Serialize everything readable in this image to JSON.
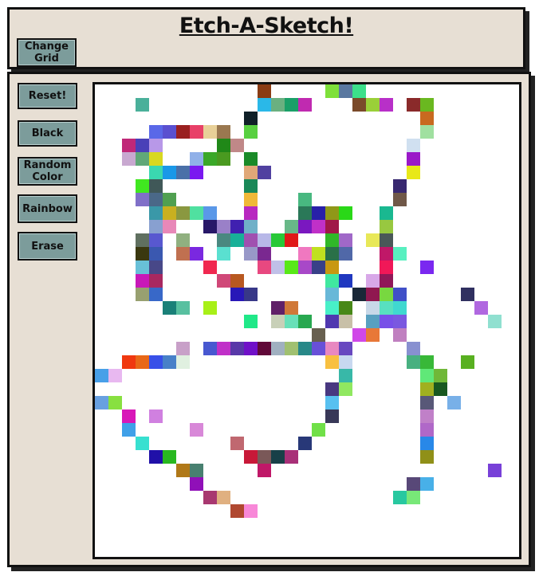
{
  "header": {
    "title": "Etch-A-Sketch!",
    "change_grid_label": "Change\nGrid"
  },
  "toolbar": {
    "reset_label": "Reset!",
    "black_label": "Black",
    "random_color_label": "Random\nColor",
    "rainbow_label": "Rainbow",
    "erase_label": "Erase"
  },
  "grid": {
    "columns": 30,
    "rows": 33,
    "background": "#ffffff",
    "cells": [
      [
        12,
        0,
        "#8a3c14"
      ],
      [
        17,
        0,
        "#7ee03a"
      ],
      [
        18,
        0,
        "#5a78a0"
      ],
      [
        19,
        0,
        "#3ce08a"
      ],
      [
        3,
        1,
        "#4ab09a"
      ],
      [
        12,
        1,
        "#2ab8e8"
      ],
      [
        13,
        1,
        "#6ab080"
      ],
      [
        14,
        1,
        "#1aa068"
      ],
      [
        15,
        1,
        "#c02ab0"
      ],
      [
        19,
        1,
        "#7a4a2a"
      ],
      [
        20,
        1,
        "#9ad038"
      ],
      [
        21,
        1,
        "#b830c8"
      ],
      [
        23,
        1,
        "#8a2a2a"
      ],
      [
        24,
        1,
        "#6ab820"
      ],
      [
        11,
        2,
        "#102028"
      ],
      [
        24,
        2,
        "#c86a20"
      ],
      [
        4,
        3,
        "#5a68e8"
      ],
      [
        5,
        3,
        "#5a50d0"
      ],
      [
        6,
        3,
        "#9a2020"
      ],
      [
        7,
        3,
        "#e84068"
      ],
      [
        8,
        3,
        "#e8d098"
      ],
      [
        9,
        3,
        "#9a7850"
      ],
      [
        11,
        3,
        "#58d040"
      ],
      [
        24,
        3,
        "#a0e0a0"
      ],
      [
        2,
        4,
        "#c02878"
      ],
      [
        3,
        4,
        "#4a40b8"
      ],
      [
        4,
        4,
        "#b898e8"
      ],
      [
        9,
        4,
        "#208818"
      ],
      [
        10,
        4,
        "#c08888"
      ],
      [
        23,
        4,
        "#d0e0f0"
      ],
      [
        2,
        5,
        "#c8a8d0"
      ],
      [
        3,
        5,
        "#60a878"
      ],
      [
        4,
        5,
        "#d8d820"
      ],
      [
        7,
        5,
        "#90b0e8"
      ],
      [
        8,
        5,
        "#3aa828"
      ],
      [
        9,
        5,
        "#4a9a20"
      ],
      [
        11,
        5,
        "#1a8a28"
      ],
      [
        23,
        5,
        "#9a18c8"
      ],
      [
        4,
        6,
        "#3ad8b0"
      ],
      [
        5,
        6,
        "#1a98e8"
      ],
      [
        6,
        6,
        "#4a70a8"
      ],
      [
        7,
        6,
        "#7a18f0"
      ],
      [
        11,
        6,
        "#e0a878"
      ],
      [
        12,
        6,
        "#5040a0"
      ],
      [
        23,
        6,
        "#e8e818"
      ],
      [
        3,
        7,
        "#40e820"
      ],
      [
        4,
        7,
        "#405858"
      ],
      [
        11,
        7,
        "#1a8858"
      ],
      [
        22,
        7,
        "#382870"
      ],
      [
        3,
        8,
        "#8070c8"
      ],
      [
        4,
        8,
        "#4a6888"
      ],
      [
        5,
        8,
        "#50a050"
      ],
      [
        11,
        8,
        "#f0b838"
      ],
      [
        15,
        8,
        "#48b880"
      ],
      [
        22,
        8,
        "#705848"
      ],
      [
        4,
        9,
        "#3a98a8"
      ],
      [
        5,
        9,
        "#c8b020"
      ],
      [
        6,
        9,
        "#8a9840"
      ],
      [
        7,
        9,
        "#50e0a0"
      ],
      [
        8,
        9,
        "#5a98e8"
      ],
      [
        11,
        9,
        "#b828c0"
      ],
      [
        15,
        9,
        "#2a7858"
      ],
      [
        16,
        9,
        "#2820a8"
      ],
      [
        17,
        9,
        "#909818"
      ],
      [
        18,
        9,
        "#2ad818"
      ],
      [
        21,
        9,
        "#1ab890"
      ],
      [
        4,
        10,
        "#88a0d0"
      ],
      [
        5,
        10,
        "#e888b8"
      ],
      [
        8,
        10,
        "#281868"
      ],
      [
        9,
        10,
        "#9a80c8"
      ],
      [
        10,
        10,
        "#4020b0"
      ],
      [
        11,
        10,
        "#70b0c8"
      ],
      [
        14,
        10,
        "#68b888"
      ],
      [
        15,
        10,
        "#7a18c0"
      ],
      [
        16,
        10,
        "#c030c8"
      ],
      [
        17,
        10,
        "#a01848"
      ],
      [
        21,
        10,
        "#98c840"
      ],
      [
        3,
        11,
        "#607060"
      ],
      [
        4,
        11,
        "#5858d0"
      ],
      [
        6,
        11,
        "#90b080"
      ],
      [
        9,
        11,
        "#4a8880"
      ],
      [
        10,
        11,
        "#18b098"
      ],
      [
        11,
        11,
        "#a050b0"
      ],
      [
        12,
        11,
        "#b8b8e8"
      ],
      [
        13,
        11,
        "#28c838"
      ],
      [
        14,
        11,
        "#e01818"
      ],
      [
        17,
        11,
        "#30b828"
      ],
      [
        18,
        11,
        "#a068c8"
      ],
      [
        20,
        11,
        "#e8e858"
      ],
      [
        21,
        11,
        "#4a5858"
      ],
      [
        3,
        12,
        "#3a3810"
      ],
      [
        4,
        12,
        "#3a58b0"
      ],
      [
        6,
        12,
        "#c07050"
      ],
      [
        7,
        12,
        "#7a28e0"
      ],
      [
        9,
        12,
        "#5ae0d0"
      ],
      [
        11,
        12,
        "#9898c8"
      ],
      [
        12,
        12,
        "#7a2890"
      ],
      [
        15,
        12,
        "#f078c0"
      ],
      [
        16,
        12,
        "#c0e020"
      ],
      [
        17,
        12,
        "#2a7048"
      ],
      [
        18,
        12,
        "#5068a8"
      ],
      [
        21,
        12,
        "#c01868"
      ],
      [
        22,
        12,
        "#58f0c0"
      ],
      [
        3,
        13,
        "#68c0d8"
      ],
      [
        4,
        13,
        "#484888"
      ],
      [
        8,
        13,
        "#f02850"
      ],
      [
        12,
        13,
        "#e84880"
      ],
      [
        13,
        13,
        "#c0c0e8"
      ],
      [
        14,
        13,
        "#58e818"
      ],
      [
        15,
        13,
        "#a848c8"
      ],
      [
        16,
        13,
        "#384088"
      ],
      [
        17,
        13,
        "#c89810"
      ],
      [
        21,
        13,
        "#f01858"
      ],
      [
        24,
        13,
        "#7a28f0"
      ],
      [
        3,
        14,
        "#c818b8"
      ],
      [
        4,
        14,
        "#a82860"
      ],
      [
        9,
        14,
        "#d04878"
      ],
      [
        10,
        14,
        "#b85820"
      ],
      [
        17,
        14,
        "#40e8a0"
      ],
      [
        18,
        14,
        "#2038c0"
      ],
      [
        20,
        14,
        "#d8a8e8"
      ],
      [
        21,
        14,
        "#901858"
      ],
      [
        3,
        15,
        "#98a070"
      ],
      [
        4,
        15,
        "#3868c8"
      ],
      [
        10,
        15,
        "#2818b8"
      ],
      [
        11,
        15,
        "#383888"
      ],
      [
        17,
        15,
        "#68b8d8"
      ],
      [
        19,
        15,
        "#1a2838"
      ],
      [
        20,
        15,
        "#901850"
      ],
      [
        21,
        15,
        "#78d840"
      ],
      [
        22,
        15,
        "#4050c8"
      ],
      [
        27,
        15,
        "#303060"
      ],
      [
        5,
        16,
        "#1a8078"
      ],
      [
        6,
        16,
        "#58c0a0"
      ],
      [
        8,
        16,
        "#a8f018"
      ],
      [
        13,
        16,
        "#602068"
      ],
      [
        14,
        16,
        "#d07838"
      ],
      [
        17,
        16,
        "#48f0c8"
      ],
      [
        18,
        16,
        "#488818"
      ],
      [
        20,
        16,
        "#c8d8e8"
      ],
      [
        21,
        16,
        "#58e0c0"
      ],
      [
        22,
        16,
        "#40d8d0"
      ],
      [
        28,
        16,
        "#b068e0"
      ],
      [
        11,
        17,
        "#20e888"
      ],
      [
        13,
        17,
        "#c8d0b8"
      ],
      [
        14,
        17,
        "#68e0b8"
      ],
      [
        15,
        17,
        "#28a850"
      ],
      [
        17,
        17,
        "#5038b0"
      ],
      [
        18,
        17,
        "#c8c0a8"
      ],
      [
        20,
        17,
        "#58a0c0"
      ],
      [
        21,
        17,
        "#7850e8"
      ],
      [
        22,
        17,
        "#7a58e0"
      ],
      [
        29,
        17,
        "#90e0d0"
      ],
      [
        16,
        18,
        "#686050"
      ],
      [
        19,
        18,
        "#d048e8"
      ],
      [
        20,
        18,
        "#e87838"
      ],
      [
        22,
        18,
        "#c080c0"
      ],
      [
        6,
        19,
        "#c8a0c8"
      ],
      [
        8,
        19,
        "#4858d0"
      ],
      [
        9,
        19,
        "#c030c8"
      ],
      [
        10,
        19,
        "#5838a8"
      ],
      [
        11,
        19,
        "#7010c8"
      ],
      [
        12,
        19,
        "#600838"
      ],
      [
        13,
        19,
        "#a0b0c0"
      ],
      [
        14,
        19,
        "#a0c070"
      ],
      [
        15,
        19,
        "#288888"
      ],
      [
        16,
        19,
        "#6850d8"
      ],
      [
        17,
        19,
        "#e888c0"
      ],
      [
        18,
        19,
        "#6848c0"
      ],
      [
        23,
        19,
        "#8890d0"
      ],
      [
        2,
        20,
        "#f03810"
      ],
      [
        3,
        20,
        "#e86818"
      ],
      [
        4,
        20,
        "#3850e8"
      ],
      [
        5,
        20,
        "#4880c8"
      ],
      [
        6,
        20,
        "#e0f0e0"
      ],
      [
        17,
        20,
        "#f8c040"
      ],
      [
        18,
        20,
        "#c8d8f0"
      ],
      [
        23,
        20,
        "#48b080"
      ],
      [
        24,
        20,
        "#38b838"
      ],
      [
        27,
        20,
        "#58b020"
      ],
      [
        0,
        21,
        "#48a0e8"
      ],
      [
        1,
        21,
        "#e8b8f0"
      ],
      [
        18,
        21,
        "#38b8a8"
      ],
      [
        24,
        21,
        "#60e878"
      ],
      [
        25,
        21,
        "#70b838"
      ],
      [
        17,
        22,
        "#483880"
      ],
      [
        18,
        22,
        "#90e860"
      ],
      [
        24,
        22,
        "#a0b020"
      ],
      [
        25,
        22,
        "#185820"
      ],
      [
        0,
        23,
        "#68a0e0"
      ],
      [
        1,
        23,
        "#88e040"
      ],
      [
        17,
        23,
        "#58c0f0"
      ],
      [
        24,
        23,
        "#585878"
      ],
      [
        26,
        23,
        "#78b0e8"
      ],
      [
        2,
        24,
        "#d818b8"
      ],
      [
        4,
        24,
        "#d080e0"
      ],
      [
        17,
        24,
        "#383858"
      ],
      [
        24,
        24,
        "#c080c8"
      ],
      [
        2,
        25,
        "#40a0e8"
      ],
      [
        7,
        25,
        "#d888d8"
      ],
      [
        16,
        25,
        "#70e048"
      ],
      [
        24,
        25,
        "#b068c8"
      ],
      [
        3,
        26,
        "#38e0d0"
      ],
      [
        10,
        26,
        "#c06870"
      ],
      [
        15,
        26,
        "#283878"
      ],
      [
        24,
        26,
        "#2888e8"
      ],
      [
        4,
        27,
        "#2010a8"
      ],
      [
        5,
        27,
        "#28b820"
      ],
      [
        11,
        27,
        "#c81838"
      ],
      [
        12,
        27,
        "#7a5858"
      ],
      [
        13,
        27,
        "#184048"
      ],
      [
        14,
        27,
        "#a83078"
      ],
      [
        24,
        27,
        "#909018"
      ],
      [
        6,
        28,
        "#b07818"
      ],
      [
        7,
        28,
        "#488070"
      ],
      [
        12,
        28,
        "#c01868"
      ],
      [
        29,
        28,
        "#7840d8"
      ],
      [
        7,
        29,
        "#9010b8"
      ],
      [
        23,
        29,
        "#584878"
      ],
      [
        24,
        29,
        "#48b0e8"
      ],
      [
        8,
        30,
        "#a83870"
      ],
      [
        9,
        30,
        "#e0b080"
      ],
      [
        22,
        30,
        "#28c8a0"
      ],
      [
        23,
        30,
        "#78e878"
      ],
      [
        10,
        31,
        "#b04830"
      ],
      [
        11,
        31,
        "#f888d8"
      ]
    ]
  }
}
